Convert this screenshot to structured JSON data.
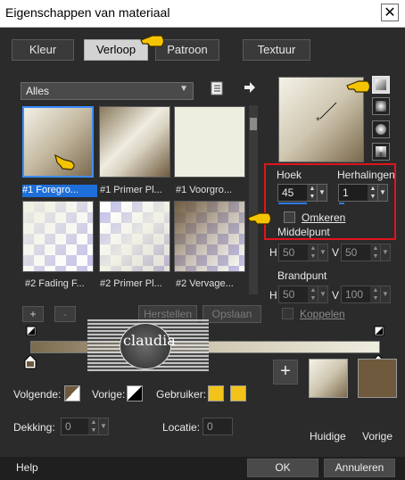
{
  "window": {
    "title": "Eigenschappen van materiaal",
    "close_label": "✕"
  },
  "tabs": [
    {
      "label": "Kleur",
      "active": false
    },
    {
      "label": "Verloop",
      "active": true
    },
    {
      "label": "Patroon",
      "active": false
    },
    {
      "label": "Textuur",
      "active": false
    }
  ],
  "library": {
    "dropdown_value": "Alles",
    "thumbnails": [
      {
        "label": "#1 Foregro...",
        "selected": true,
        "kind": "gradient-fg"
      },
      {
        "label": "#1 Primer Pl...",
        "selected": false,
        "kind": "gradient-diag"
      },
      {
        "label": "#1 Voorgro...",
        "selected": false,
        "kind": "solid-light"
      },
      {
        "label": "#2 Fading F...",
        "selected": false,
        "kind": "fade"
      },
      {
        "label": "#2 Primer Pl...",
        "selected": false,
        "kind": "fade"
      },
      {
        "label": "#2 Vervage...",
        "selected": false,
        "kind": "fade-brown"
      }
    ]
  },
  "angle": {
    "label": "Hoek",
    "value": "45"
  },
  "repeats": {
    "label": "Herhalingen",
    "value": "1"
  },
  "invert": {
    "label": "Omkeren",
    "checked": false
  },
  "center": {
    "title": "Middelpunt",
    "h_label": "H",
    "h_value": "50",
    "v_label": "V",
    "v_value": "50"
  },
  "focal": {
    "title": "Brandpunt",
    "h_label": "H",
    "h_value": "50",
    "v_label": "V",
    "v_value": "100",
    "link_label": "Koppelen"
  },
  "editor": {
    "add_label": "+",
    "remove_label": "-",
    "restore_label": "Herstellen",
    "save_label": "Opslaan"
  },
  "watermark": {
    "text": "claudia",
    "subtext": ""
  },
  "colors": {
    "following_label": "Volgende:",
    "previous_label": "Vorige:",
    "user_label": "Gebruiker:",
    "brown": "#6f5a3e",
    "light": "#eeeedf",
    "gold": "#f2c31a",
    "accent_blue": "#2d7ae6",
    "highlight_red": "#e0141c"
  },
  "opacity": {
    "label": "Dekking:",
    "value": "0"
  },
  "location": {
    "label": "Locatie:",
    "value": "0"
  },
  "preview": {
    "current_label": "Huidige",
    "previous_label": "Vorige",
    "add_label": "+"
  },
  "footer": {
    "help_label": "Help",
    "ok_label": "OK",
    "cancel_label": "Annuleren"
  },
  "icons": [
    "close-icon",
    "edit-gradient-icon",
    "arrow-right-icon",
    "pointing-hand-icon",
    "chevron-down-icon",
    "stop-marker-icon"
  ]
}
